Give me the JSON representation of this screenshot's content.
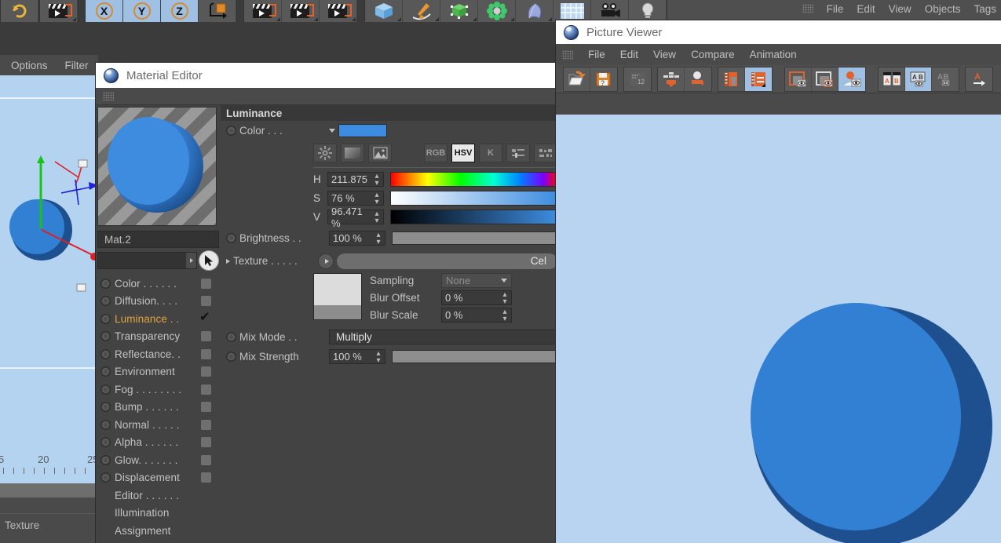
{
  "app": {
    "top_menu": [
      "File",
      "Edit",
      "View",
      "Objects",
      "Tags"
    ],
    "toolbar_icons": [
      "undo-icon",
      "render-view-icon",
      "axis-x-icon",
      "axis-y-icon",
      "axis-z-icon",
      "world-object-axis-icon",
      "render-region-icon",
      "render-picture-viewer-icon",
      "render-settings-icon",
      "cube-primitive-icon",
      "spline-pen-icon",
      "nurbs-generator-icon",
      "array-modeling-icon",
      "deformer-icon",
      "environment-floor-icon",
      "camera-icon",
      "light-icon"
    ],
    "axis_labels": [
      "X",
      "Y",
      "Z"
    ]
  },
  "viewport": {
    "menu": [
      "Options",
      "Filter"
    ],
    "ruler_labels": [
      "5",
      "20",
      "25"
    ],
    "bottom_label": "Texture"
  },
  "material_editor": {
    "title": "Material Editor",
    "app_icon": "cinema4d-orb-icon",
    "material_name": "Mat.2",
    "search_placeholder": "",
    "cursor_icon": "pick-cursor-icon",
    "channels": [
      {
        "label": "Color . . . . . .",
        "active": false,
        "checked": false
      },
      {
        "label": "Diffusion. . . .",
        "active": false,
        "checked": false
      },
      {
        "label": "Luminance . .",
        "active": true,
        "checked": true
      },
      {
        "label": "Transparency",
        "active": false,
        "checked": false
      },
      {
        "label": "Reflectance. .",
        "active": false,
        "checked": false
      },
      {
        "label": "Environment",
        "active": false,
        "checked": false
      },
      {
        "label": "Fog . . . . . . . .",
        "active": false,
        "checked": false
      },
      {
        "label": "Bump . . . . . .",
        "active": false,
        "checked": false
      },
      {
        "label": "Normal . . . . .",
        "active": false,
        "checked": false
      },
      {
        "label": "Alpha . . . . . .",
        "active": false,
        "checked": false
      },
      {
        "label": "Glow. . . . . . .",
        "active": false,
        "checked": false
      },
      {
        "label": "Displacement",
        "active": false,
        "checked": false
      }
    ],
    "plain_items": [
      "Editor . . . . . .",
      "Illumination",
      "Assignment"
    ],
    "panel": {
      "section_title": "Luminance",
      "color_label": "Color . . .",
      "color_swatch": "#3d8ce0",
      "mode_buttons": [
        {
          "label": "RGB",
          "active": false,
          "name": "rgb-mode-button"
        },
        {
          "label": "HSV",
          "active": true,
          "name": "hsv-mode-button"
        },
        {
          "label": "K",
          "active": false,
          "name": "kelvin-mode-button"
        }
      ],
      "picker_icons": [
        "color-wheel-icon",
        "gradient-swatch-icon",
        "image-picker-icon"
      ],
      "extra_icons": [
        "sliders-icon",
        "swatches-icon"
      ],
      "hsv": [
        {
          "channel": "H",
          "value": "211.875"
        },
        {
          "channel": "S",
          "value": "76 %"
        },
        {
          "channel": "V",
          "value": "96.471 %"
        }
      ],
      "brightness_label": "Brightness . .",
      "brightness_value": "100 %",
      "texture_label": "Texture . . . . .",
      "texture_value": "Cel",
      "sampling_label": "Sampling",
      "sampling_value": "None",
      "blur_offset_label": "Blur Offset",
      "blur_offset_value": "0 %",
      "blur_scale_label": "Blur Scale",
      "blur_scale_value": "0 %",
      "mix_mode_label": "Mix Mode . .",
      "mix_mode_value": "Multiply",
      "mix_strength_label": "Mix Strength",
      "mix_strength_value": "100 %"
    }
  },
  "picture_viewer": {
    "title": "Picture Viewer",
    "app_icon": "cinema4d-orb-icon",
    "menu": [
      "File",
      "Edit",
      "View",
      "Compare",
      "Animation"
    ],
    "toolbar": [
      {
        "name": "open-file-icon",
        "selected": false
      },
      {
        "name": "save-file-icon",
        "selected": false
      },
      {
        "name": "render-settings-icon",
        "selected": false
      },
      {
        "name": "send-to-layers-icon",
        "selected": false
      },
      {
        "name": "send-to-object-icon",
        "selected": false
      },
      {
        "name": "delete-image-icon",
        "selected": false
      },
      {
        "name": "history-list-icon",
        "selected": true
      },
      {
        "name": "region-view-a-icon",
        "selected": false
      },
      {
        "name": "region-view-b-icon",
        "selected": false
      },
      {
        "name": "preview-user-icon",
        "selected": true
      },
      {
        "name": "compare-ab-split-icon",
        "selected": false
      },
      {
        "name": "compare-ab-overlay-icon",
        "selected": true
      },
      {
        "name": "compare-ab-diff-icon",
        "selected": false
      },
      {
        "name": "set-a-icon",
        "selected": false
      }
    ],
    "canvas_background": "#b8d4f0",
    "sphere_lit_color": "#3180d4",
    "sphere_shadow_color": "#1e4f8f"
  }
}
